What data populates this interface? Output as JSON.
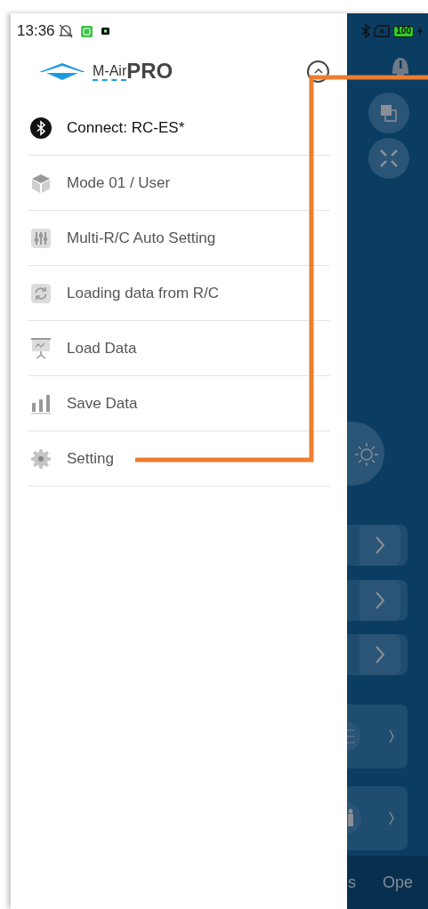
{
  "status_bar": {
    "time": "13:36",
    "battery": "100"
  },
  "logo": {
    "name": "M-Air",
    "suffix": "PRO"
  },
  "menu": [
    {
      "label": "Connect: RC-ES*",
      "kind": "bluetooth",
      "active": true
    },
    {
      "label": "Mode 01 / User",
      "kind": "mode",
      "active": false
    },
    {
      "label": "Multi-R/C Auto Setting",
      "kind": "multi",
      "active": false
    },
    {
      "label": "Loading data from R/C",
      "kind": "loading",
      "active": false
    },
    {
      "label": "Load Data",
      "kind": "load",
      "active": false
    },
    {
      "label": "Save Data",
      "kind": "save",
      "active": false
    },
    {
      "label": "Setting",
      "kind": "setting",
      "active": false
    }
  ],
  "background_screen": {
    "bottom_tabs": [
      "s",
      "Ope"
    ]
  }
}
